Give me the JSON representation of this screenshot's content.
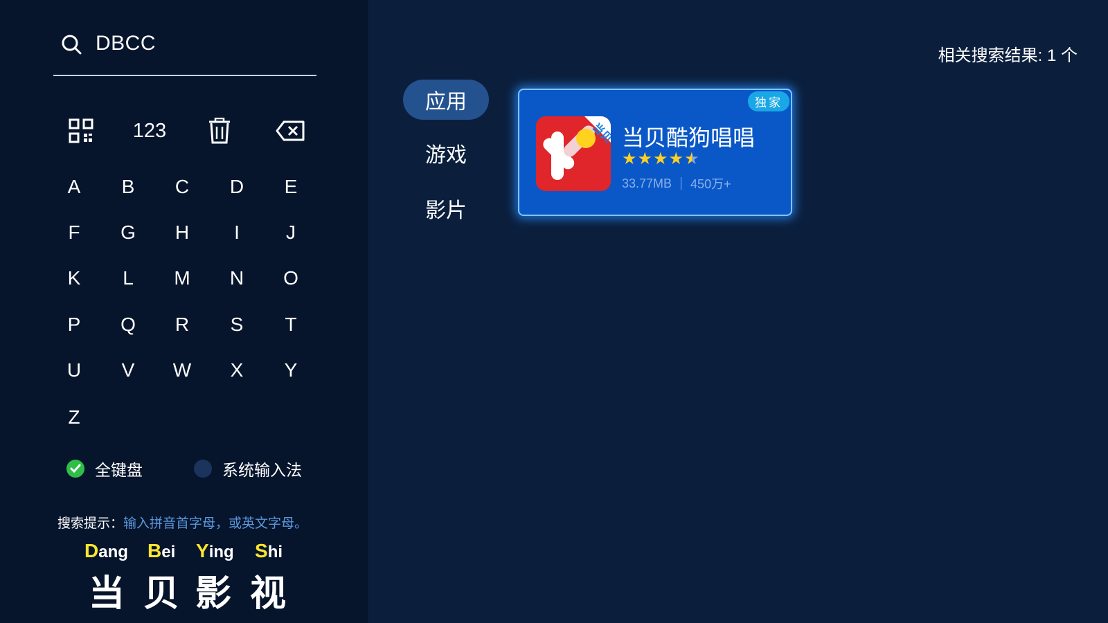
{
  "search": {
    "query": "DBCC"
  },
  "function_keys": {
    "qr": "qr-code-icon",
    "numbers": "123",
    "clear": "trash-icon",
    "backspace": "backspace-icon"
  },
  "keyboard": {
    "letters": [
      "A",
      "B",
      "C",
      "D",
      "E",
      "F",
      "G",
      "H",
      "I",
      "J",
      "K",
      "L",
      "M",
      "N",
      "O",
      "P",
      "Q",
      "R",
      "S",
      "T",
      "U",
      "V",
      "W",
      "X",
      "Y",
      "Z"
    ]
  },
  "input_modes": {
    "full_keyboard": {
      "label": "全键盘",
      "selected": true
    },
    "system_ime": {
      "label": "系统输入法",
      "selected": false
    }
  },
  "hint": {
    "label": "搜索提示：",
    "text": "输入拼音首字母，或英文字母。"
  },
  "pinyin_example": [
    {
      "initial": "D",
      "rest": "ang",
      "char": "当"
    },
    {
      "initial": "B",
      "rest": "ei",
      "char": "贝"
    },
    {
      "initial": "Y",
      "rest": "ing",
      "char": "影"
    },
    {
      "initial": "S",
      "rest": "hi",
      "char": "视"
    }
  ],
  "tabs": [
    {
      "label": "应用",
      "active": true
    },
    {
      "label": "游戏",
      "active": false
    },
    {
      "label": "影片",
      "active": false
    }
  ],
  "results": {
    "count_text": "相关搜索结果: 1 个"
  },
  "app": {
    "badge": "独家",
    "name": "当贝酷狗唱唱",
    "rating": 4.5,
    "size": "33.77MB",
    "downloads": "450万+",
    "icon_text": "当贝"
  },
  "colors": {
    "accent": "#0a58c8",
    "pinyin_initial": "#ffe52e",
    "hint": "#5a97dc",
    "selected_radio": "#2fbf48"
  }
}
